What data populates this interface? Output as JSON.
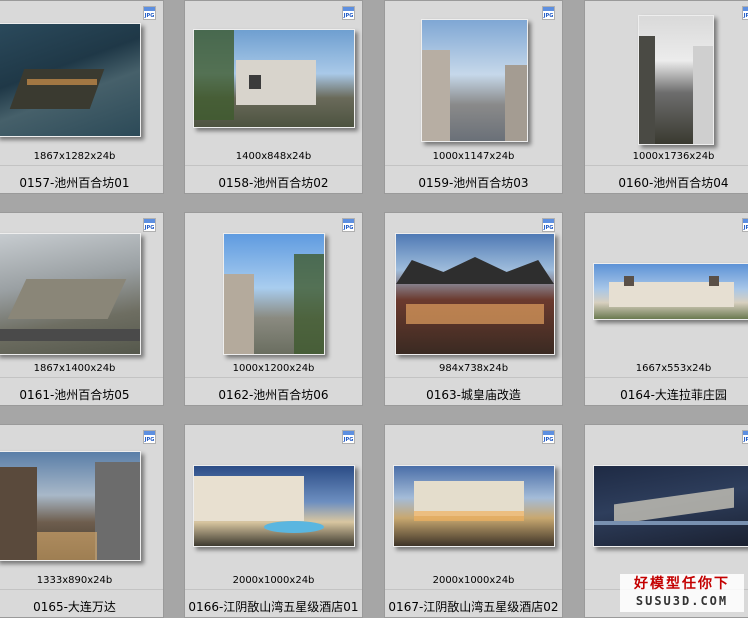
{
  "badge_text": "JPG",
  "tiles": [
    {
      "dims": "1867x1282x24b",
      "name": "0157-池州百合坊01"
    },
    {
      "dims": "1400x848x24b",
      "name": "0158-池州百合坊02"
    },
    {
      "dims": "1000x1147x24b",
      "name": "0159-池州百合坊03"
    },
    {
      "dims": "1000x1736x24b",
      "name": "0160-池州百合坊04"
    },
    {
      "dims": "1867x1400x24b",
      "name": "0161-池州百合坊05"
    },
    {
      "dims": "1000x1200x24b",
      "name": "0162-池州百合坊06"
    },
    {
      "dims": "984x738x24b",
      "name": "0163-城皇庙改造"
    },
    {
      "dims": "1667x553x24b",
      "name": "0164-大连拉菲庄园"
    },
    {
      "dims": "1333x890x24b",
      "name": "0165-大连万达"
    },
    {
      "dims": "2000x1000x24b",
      "name": "0166-江阴敔山湾五星级酒店01"
    },
    {
      "dims": "2000x1000x24b",
      "name": "0167-江阴敔山湾五星级酒店02"
    },
    {
      "dims": "",
      "name": ""
    }
  ],
  "watermark": {
    "top": "好模型任你下",
    "bottom": "SUSU3D.COM"
  }
}
